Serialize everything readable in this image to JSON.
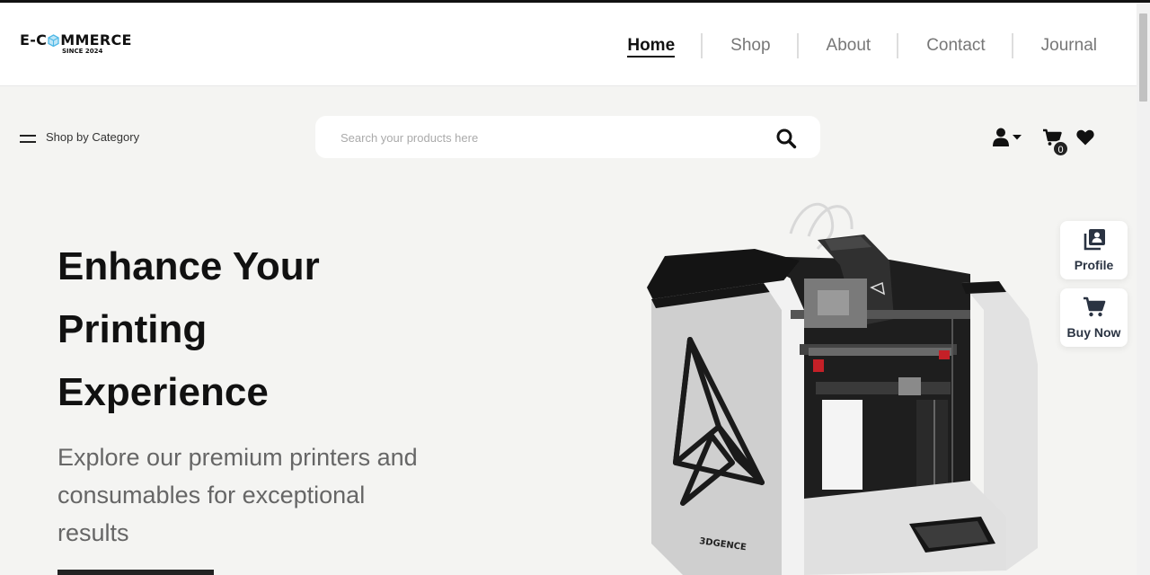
{
  "brand": {
    "name_part1": "E-C",
    "name_part2": "MMERCE",
    "tagline": "SINCE 2024"
  },
  "nav": {
    "items": [
      {
        "label": "Home",
        "active": true
      },
      {
        "label": "Shop",
        "active": false
      },
      {
        "label": "About",
        "active": false
      },
      {
        "label": "Contact",
        "active": false
      },
      {
        "label": "Journal",
        "active": false
      }
    ]
  },
  "category": {
    "label": "Shop by Category",
    "icon": "hamburger-icon"
  },
  "search": {
    "placeholder": "Search your products here",
    "value": "",
    "icon": "search-icon"
  },
  "actions": {
    "user_icon": "user-dropdown-icon",
    "cart_icon": "cart-icon",
    "cart_count": "0",
    "wishlist_icon": "heart-icon"
  },
  "hero": {
    "title_line1": "Enhance Your",
    "title_line2": "Printing",
    "title_line3": "Experience",
    "subtitle": "Explore our premium printers and consumables for exceptional results",
    "image": "3d-printer-image",
    "printer_brand": "3DGENCE"
  },
  "side_buttons": {
    "profile": {
      "label": "Profile",
      "icon": "profile-book-icon"
    },
    "buy": {
      "label": "Buy Now",
      "icon": "cart-icon"
    }
  },
  "colors": {
    "background": "#f4f4f2",
    "text_dark": "#111111",
    "text_muted": "#666666",
    "side_button_text": "#2a3342",
    "logo_accent": "#4fb8e6"
  }
}
